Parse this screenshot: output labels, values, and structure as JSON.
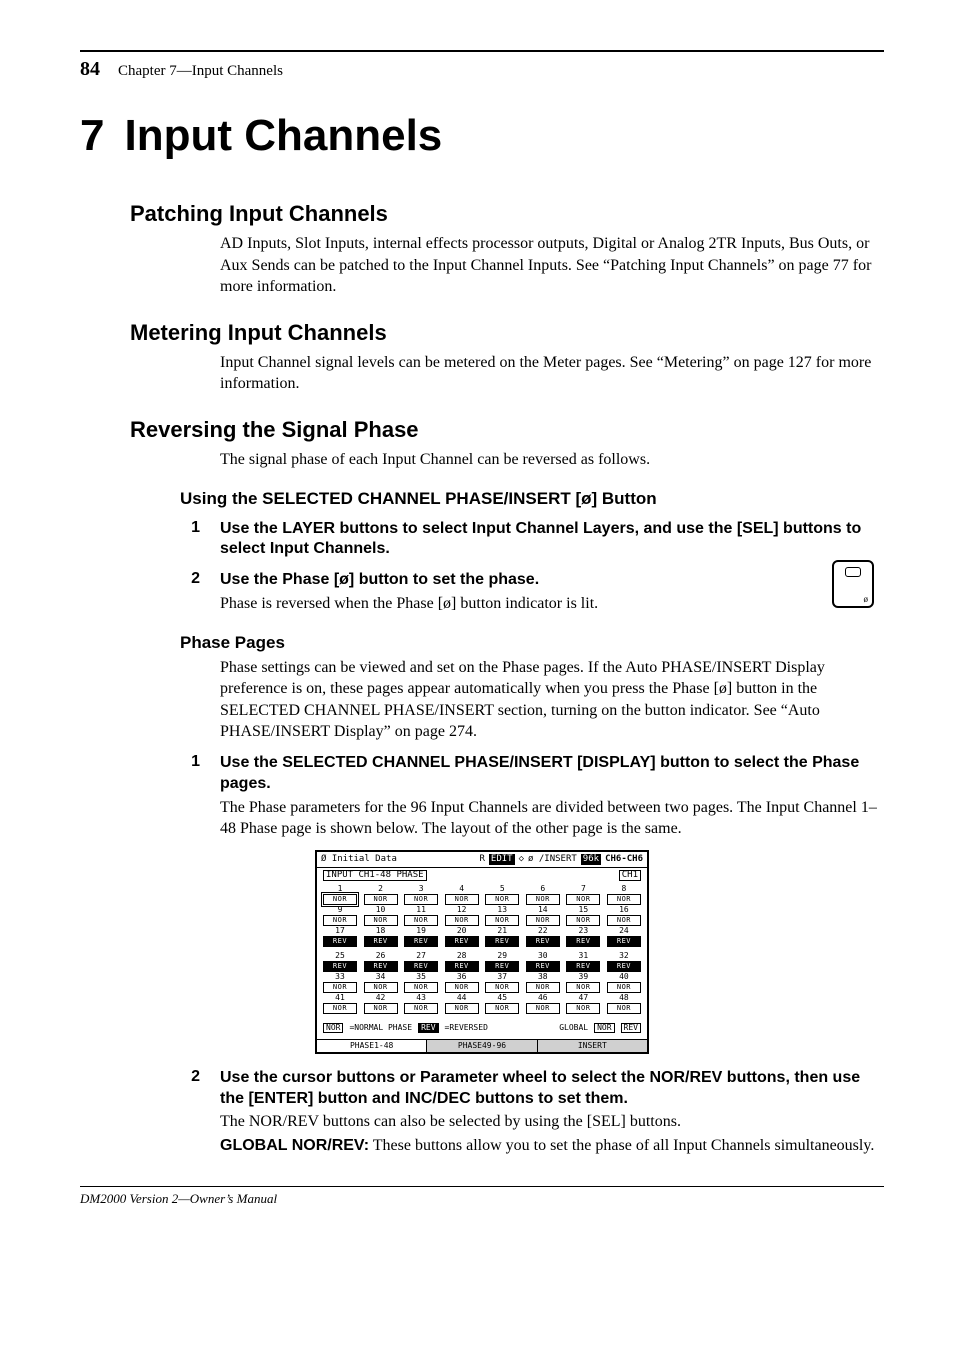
{
  "page_number": "84",
  "chapter_label": "Chapter 7—Input Channels",
  "chapter_number": "7",
  "chapter_title": "Input Channels",
  "section1": {
    "heading": "Patching Input Channels",
    "body": "AD Inputs, Slot Inputs, internal effects processor outputs, Digital or Analog 2TR Inputs, Bus Outs, or Aux Sends can be patched to the Input Channel Inputs. See “Patching Input Channels” on page 77 for more information."
  },
  "section2": {
    "heading": "Metering Input Channels",
    "body": "Input Channel signal levels can be metered on the Meter pages. See “Metering” on page 127 for more information."
  },
  "section3": {
    "heading": "Reversing the Signal Phase",
    "intro": "The signal phase of each Input Channel can be reversed as follows.",
    "sub1": {
      "heading": "Using the SELECTED CHANNEL PHASE/INSERT [ø] Button",
      "step1_num": "1",
      "step1_lead": "Use the LAYER buttons to select Input Channel Layers, and use the [SEL] buttons to select Input Channels.",
      "step2_num": "2",
      "step2_lead": "Use the Phase [ø] button to set the phase.",
      "step2_follow": "Phase is reversed when the Phase [ø] button indicator is lit."
    },
    "sub2": {
      "heading": "Phase Pages",
      "body": "Phase settings can be viewed and set on the Phase pages. If the Auto PHASE/INSERT Display preference is on, these pages appear automatically when you press the Phase [ø] button in the SELECTED CHANNEL PHASE/INSERT section, turning on the button indicator. See “Auto PHASE/INSERT Display” on page 274.",
      "step1_num": "1",
      "step1_lead": "Use the SELECTED CHANNEL PHASE/INSERT [DISPLAY] button to select the Phase pages.",
      "step1_follow": "The Phase parameters for the 96 Input Channels are divided between two pages. The Input Channel 1–48 Phase page is shown below. The layout of the other page is the same.",
      "step2_num": "2",
      "step2_lead": "Use the cursor buttons or Parameter wheel to select the NOR/REV buttons, then use the [ENTER] button and INC/DEC buttons to set them.",
      "step2_follow": "The NOR/REV buttons can also be selected by using the [SEL] buttons.",
      "global_label": "GLOBAL NOR/REV:",
      "global_body": "These buttons allow you to set the phase of all Input Channels simultaneously."
    }
  },
  "lcd": {
    "top_left": "Ø Initial Data",
    "top_edit": "EDIT",
    "top_right": "ø /INSERT",
    "top_kbd": "96k",
    "top_ch": "CH6-CH6",
    "title_left": "INPUT CH1-48 PHASE",
    "title_right": "CH1",
    "rows": [
      [
        {
          "n": "1",
          "s": "NOR",
          "sel": true
        },
        {
          "n": "2",
          "s": "NOR"
        },
        {
          "n": "3",
          "s": "NOR"
        },
        {
          "n": "4",
          "s": "NOR"
        },
        {
          "n": "5",
          "s": "NOR"
        },
        {
          "n": "6",
          "s": "NOR"
        },
        {
          "n": "7",
          "s": "NOR"
        },
        {
          "n": "8",
          "s": "NOR"
        }
      ],
      [
        {
          "n": "9",
          "s": "NOR"
        },
        {
          "n": "10",
          "s": "NOR"
        },
        {
          "n": "11",
          "s": "NOR"
        },
        {
          "n": "12",
          "s": "NOR"
        },
        {
          "n": "13",
          "s": "NOR"
        },
        {
          "n": "14",
          "s": "NOR"
        },
        {
          "n": "15",
          "s": "NOR"
        },
        {
          "n": "16",
          "s": "NOR"
        }
      ],
      [
        {
          "n": "17",
          "s": "REV"
        },
        {
          "n": "18",
          "s": "REV"
        },
        {
          "n": "19",
          "s": "REV"
        },
        {
          "n": "20",
          "s": "REV"
        },
        {
          "n": "21",
          "s": "REV"
        },
        {
          "n": "22",
          "s": "REV"
        },
        {
          "n": "23",
          "s": "REV"
        },
        {
          "n": "24",
          "s": "REV"
        }
      ],
      [
        {
          "n": "25",
          "s": "REV"
        },
        {
          "n": "26",
          "s": "REV"
        },
        {
          "n": "27",
          "s": "REV"
        },
        {
          "n": "28",
          "s": "REV"
        },
        {
          "n": "29",
          "s": "REV"
        },
        {
          "n": "30",
          "s": "REV"
        },
        {
          "n": "31",
          "s": "REV"
        },
        {
          "n": "32",
          "s": "REV"
        }
      ],
      [
        {
          "n": "33",
          "s": "NOR"
        },
        {
          "n": "34",
          "s": "NOR"
        },
        {
          "n": "35",
          "s": "NOR"
        },
        {
          "n": "36",
          "s": "NOR"
        },
        {
          "n": "37",
          "s": "NOR"
        },
        {
          "n": "38",
          "s": "NOR"
        },
        {
          "n": "39",
          "s": "NOR"
        },
        {
          "n": "40",
          "s": "NOR"
        }
      ],
      [
        {
          "n": "41",
          "s": "NOR"
        },
        {
          "n": "42",
          "s": "NOR"
        },
        {
          "n": "43",
          "s": "NOR"
        },
        {
          "n": "44",
          "s": "NOR"
        },
        {
          "n": "45",
          "s": "NOR"
        },
        {
          "n": "46",
          "s": "NOR"
        },
        {
          "n": "47",
          "s": "NOR"
        },
        {
          "n": "48",
          "s": "NOR"
        }
      ]
    ],
    "legend_nor": "NOR",
    "legend_nor_text": "=NORMAL PHASE",
    "legend_rev": "REV",
    "legend_rev_text": "=REVERSED",
    "legend_global": "GLOBAL",
    "legend_global_nor": "NOR",
    "legend_global_rev": "REV",
    "tabs": [
      "PHASE1-48",
      "PHASE49-96",
      "INSERT"
    ]
  },
  "footer": "DM2000 Version 2—Owner’s Manual"
}
